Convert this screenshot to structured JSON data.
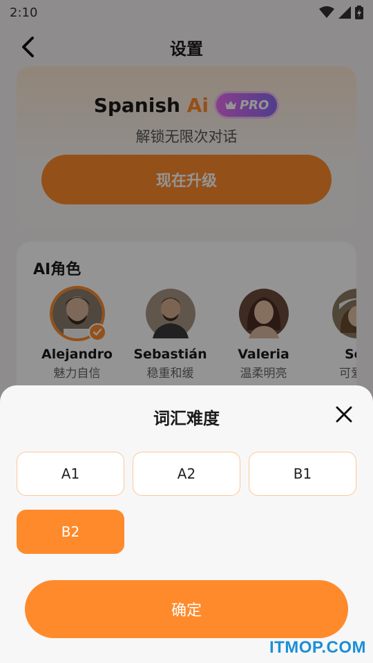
{
  "status_bar": {
    "time": "2:10"
  },
  "header": {
    "title": "设置"
  },
  "pro_card": {
    "brand_name": "Spanish",
    "brand_ai": "Ai",
    "badge": "PRO",
    "subtitle": "解锁无限次对话",
    "upgrade_label": "现在升级"
  },
  "ai_roles": {
    "title": "AI角色",
    "items": [
      {
        "name": "Alejandro",
        "trait": "魅力自信",
        "selected": true
      },
      {
        "name": "Sebastián",
        "trait": "稳重和缓",
        "selected": false
      },
      {
        "name": "Valeria",
        "trait": "温柔明亮",
        "selected": false
      },
      {
        "name": "Sof",
        "trait": "可爱莠",
        "selected": false
      }
    ]
  },
  "sheet": {
    "title": "词汇难度",
    "levels": [
      "A1",
      "A2",
      "B1",
      "B2"
    ],
    "selected_level": "B2",
    "confirm_label": "确定"
  },
  "watermark": "ITMOP.COM",
  "colors": {
    "accent": "#ff8a2b",
    "pro_gradient_start": "#e86cf0",
    "pro_gradient_end": "#8a6cf0"
  }
}
